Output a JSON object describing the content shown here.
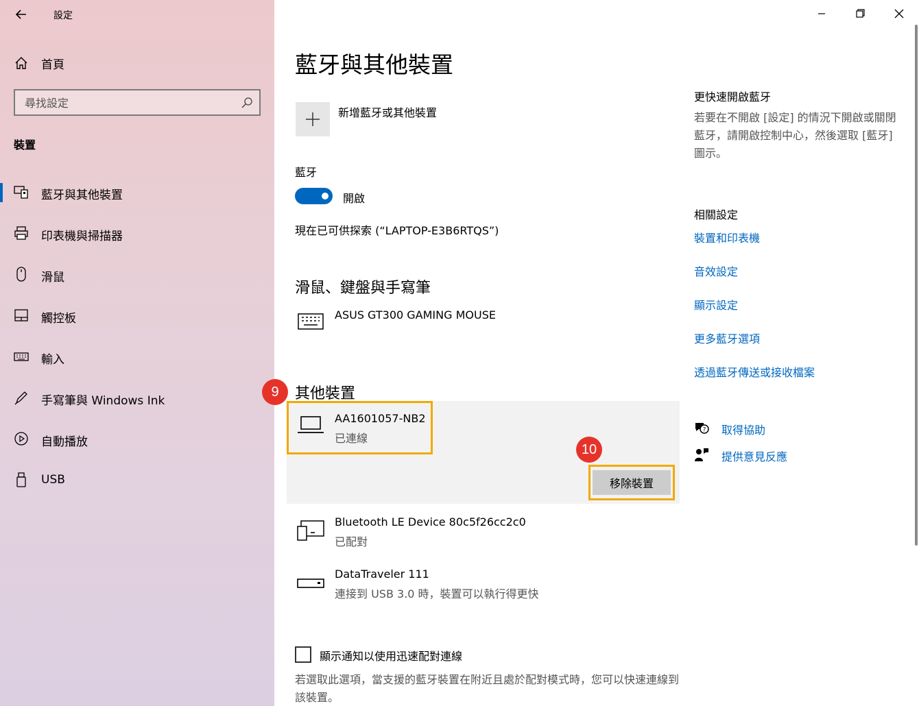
{
  "window": {
    "title": "設定"
  },
  "sidebar": {
    "home": "首頁",
    "search_placeholder": "尋找設定",
    "section": "裝置",
    "items": [
      {
        "label": "藍牙與其他裝置",
        "icon": "bluetooth-devices-icon",
        "active": true
      },
      {
        "label": "印表機與掃描器",
        "icon": "printer-icon"
      },
      {
        "label": "滑鼠",
        "icon": "mouse-icon"
      },
      {
        "label": "觸控板",
        "icon": "touchpad-icon"
      },
      {
        "label": "輸入",
        "icon": "keyboard-icon"
      },
      {
        "label": "手寫筆與 Windows Ink",
        "icon": "pen-icon"
      },
      {
        "label": "自動播放",
        "icon": "autoplay-icon"
      },
      {
        "label": "USB",
        "icon": "usb-icon"
      }
    ]
  },
  "main": {
    "title": "藍牙與其他裝置",
    "add_device": "新增藍牙或其他裝置",
    "bluetooth": {
      "heading": "藍牙",
      "toggle_state": "開啟",
      "discoverable": "現在已可供探索 (“LAPTOP-E3B6RTQS”)"
    },
    "mouse_section": {
      "title": "滑鼠、鍵盤與手寫筆",
      "devices": [
        {
          "name": "ASUS GT300 GAMING MOUSE"
        }
      ]
    },
    "other_section": {
      "title": "其他裝置",
      "devices": [
        {
          "name": "AA1601057-NB2",
          "status": "已連線"
        },
        {
          "name": "Bluetooth LE Device 80c5f26cc2c0",
          "status": "已配對"
        },
        {
          "name": "DataTraveler 111",
          "status": "連接到 USB 3.0 時，裝置可以執行得更快"
        }
      ],
      "remove_button": "移除裝置"
    },
    "swift_pair": {
      "label": "顯示通知以使用迅速配對連線",
      "description": "若選取此選項，當支援的藍牙裝置在附近且處於配對模式時，您可以快速連線到該裝置。"
    },
    "badges": {
      "step9": "9",
      "step10": "10"
    }
  },
  "right": {
    "quick_heading": "更快速開啟藍牙",
    "quick_text": "若要在不開啟 [設定] 的情況下開啟或關閉藍牙，請開啟控制中心，然後選取 [藍牙] 圖示。",
    "related_heading": "相關設定",
    "links": [
      "裝置和印表機",
      "音效設定",
      "顯示設定",
      "更多藍牙選項",
      "透過藍牙傳送或接收檔案"
    ],
    "help": "取得協助",
    "feedback": "提供意見反應"
  },
  "colors": {
    "accent": "#0067c0",
    "highlight": "#f2a900",
    "badge": "#e6332a"
  }
}
